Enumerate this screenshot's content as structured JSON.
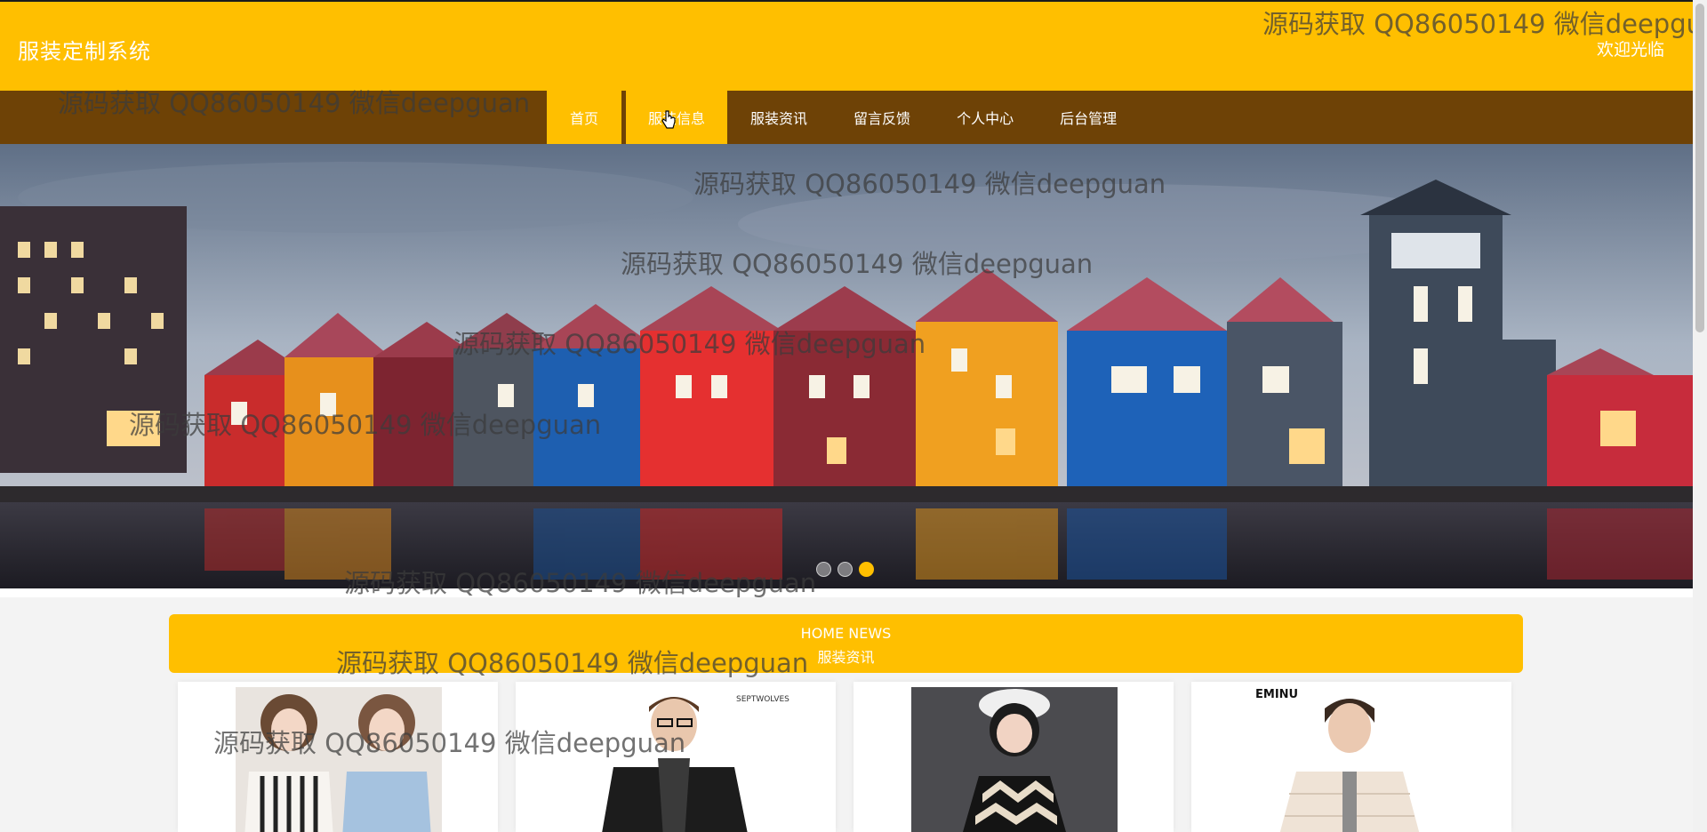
{
  "header": {
    "site_title": "服装定制系统",
    "welcome": "欢迎光临"
  },
  "nav": {
    "items": [
      {
        "label": "首页",
        "state": "active"
      },
      {
        "label": "服装信息",
        "state": "hover"
      },
      {
        "label": "服装资讯",
        "state": "normal"
      },
      {
        "label": "留言反馈",
        "state": "normal"
      },
      {
        "label": "个人中心",
        "state": "normal"
      },
      {
        "label": "后台管理",
        "state": "normal"
      }
    ]
  },
  "banner": {
    "slide_count": 3,
    "active_slide": 3
  },
  "news": {
    "title_en": "HOME NEWS",
    "title_cn": "服装资讯"
  },
  "cards": {
    "brand_marks": [
      "SEPTWOLVES",
      "EMINU"
    ]
  },
  "watermark": {
    "text": "源码获取 QQ86050149 微信deepguan"
  },
  "colors": {
    "accent": "#ffbf00",
    "nav_bg": "#6e4206",
    "page_bg": "#f3f3f3"
  }
}
